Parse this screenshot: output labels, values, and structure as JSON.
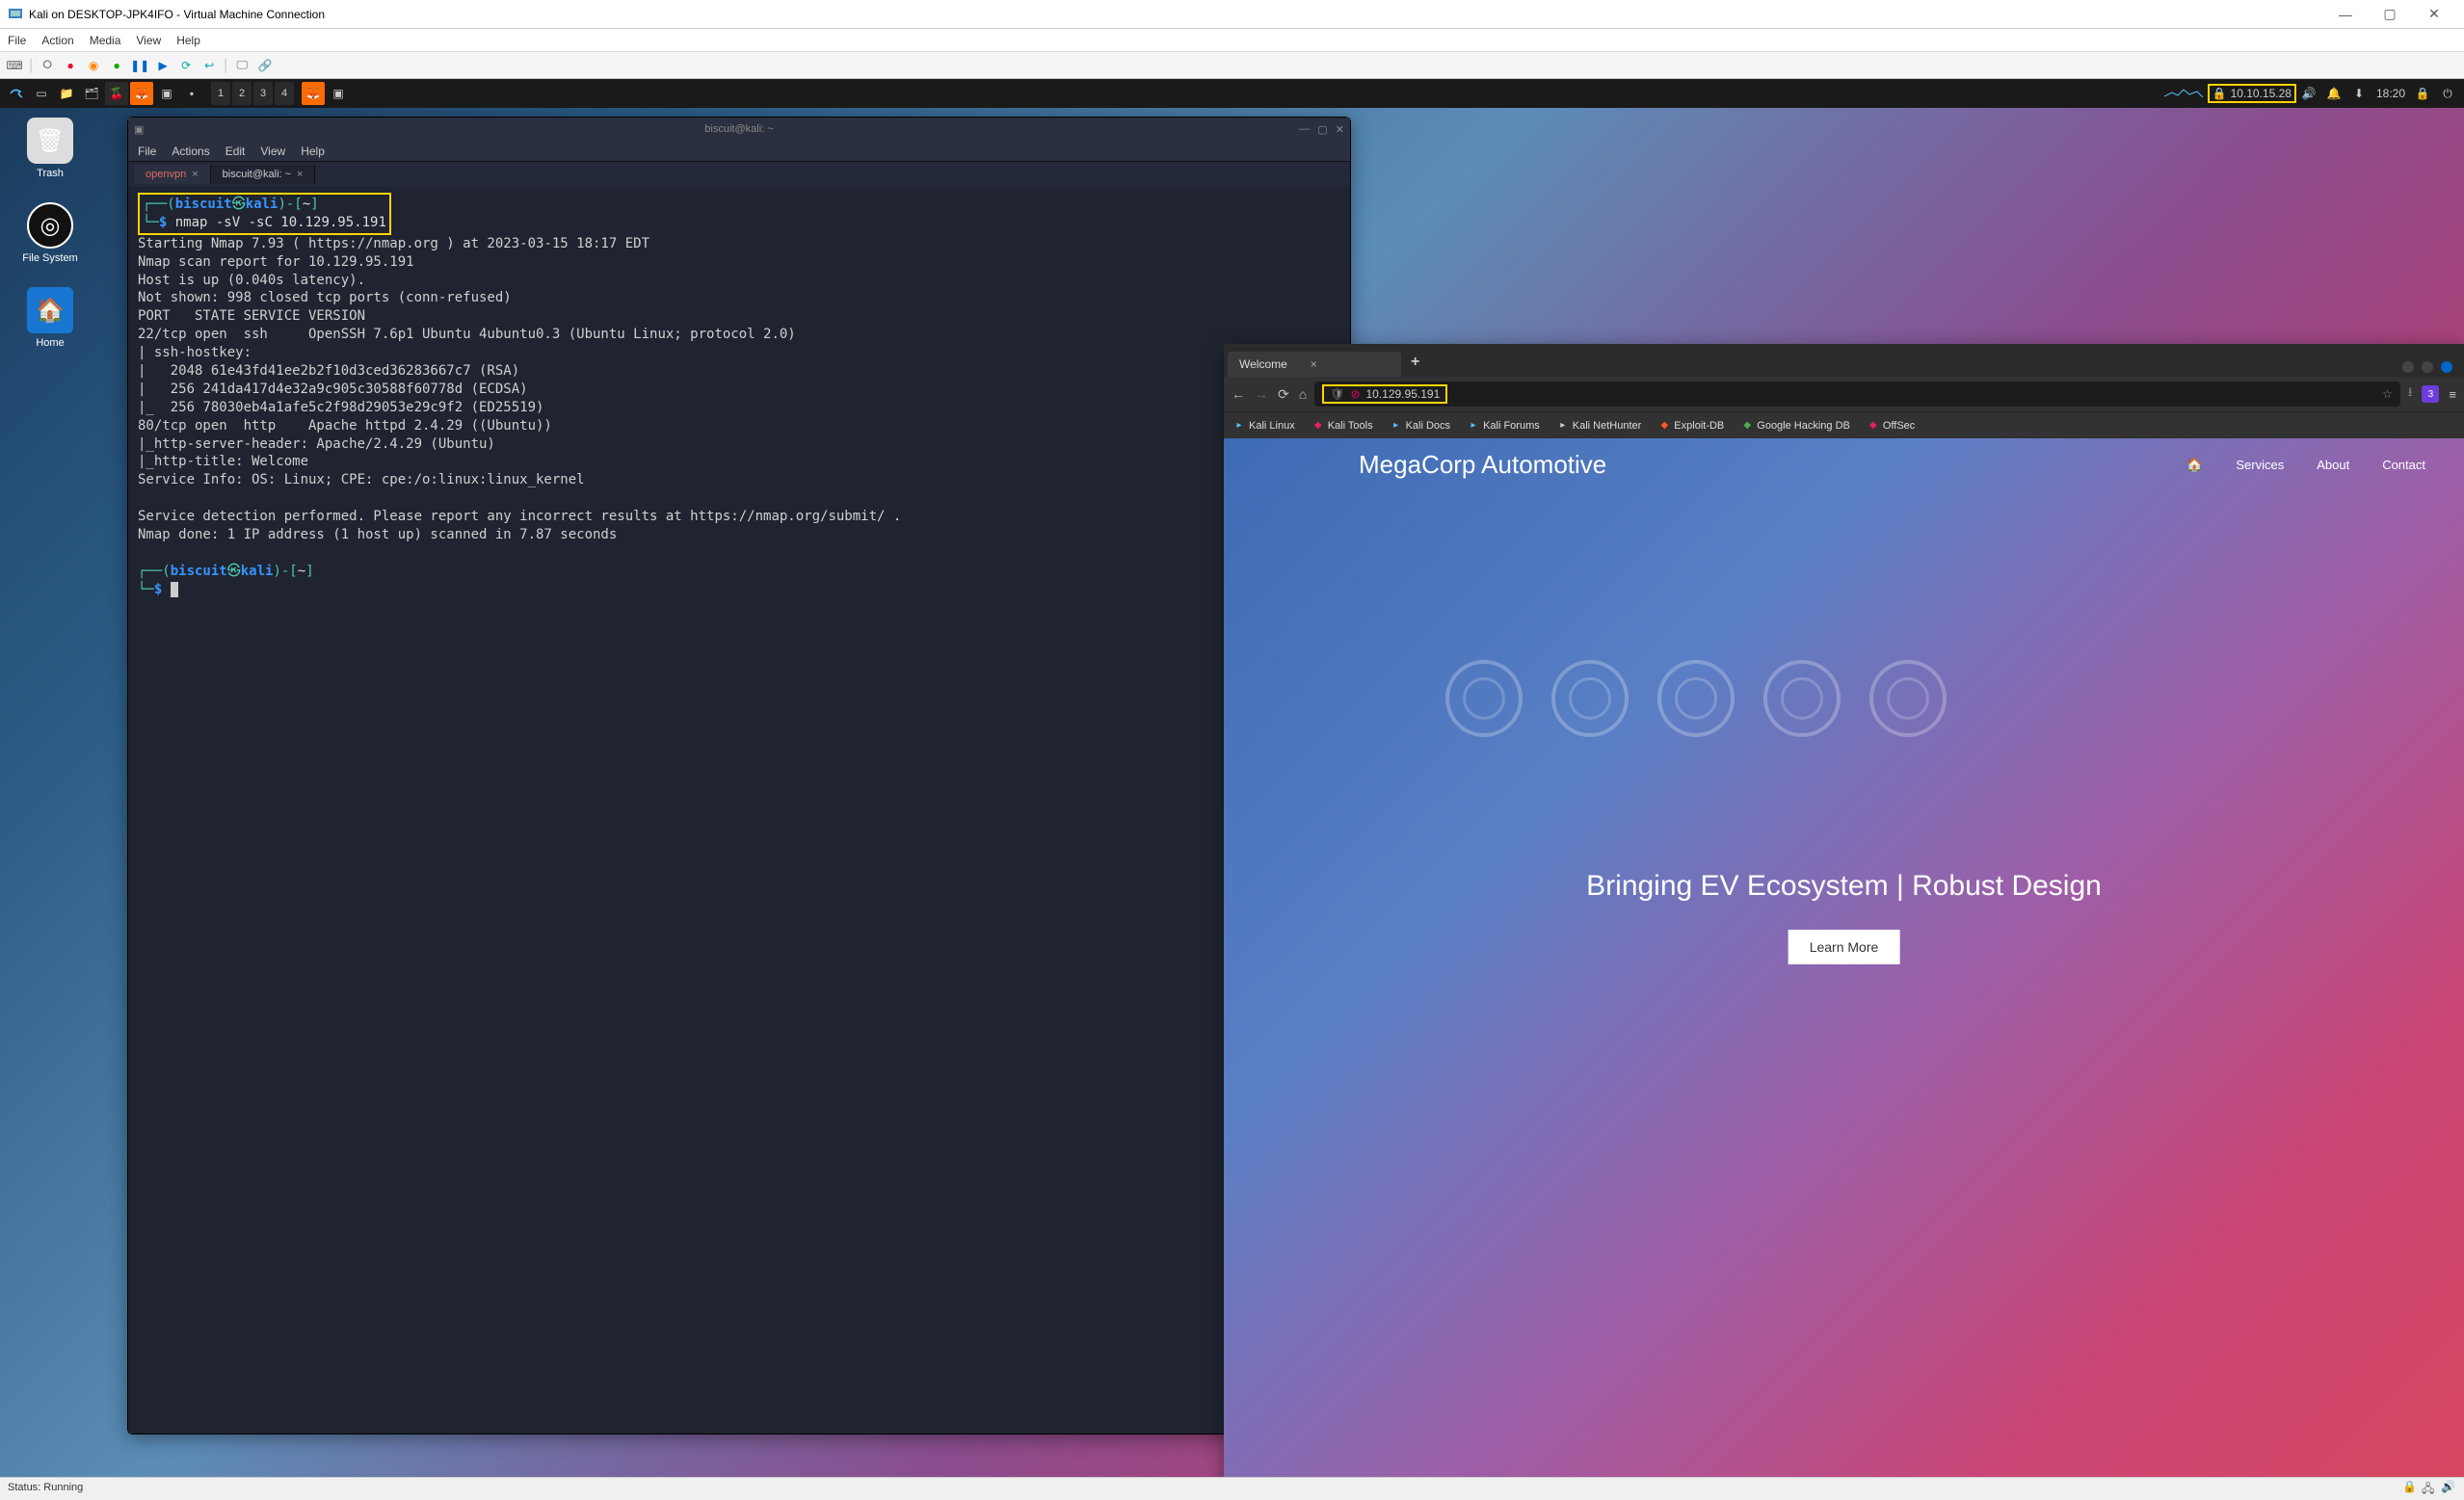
{
  "vm": {
    "title": "Kali on DESKTOP-JPK4IFO - Virtual Machine Connection",
    "menu": [
      "File",
      "Action",
      "Media",
      "View",
      "Help"
    ],
    "status": "Status: Running"
  },
  "kali_panel": {
    "workspaces": [
      "1",
      "2",
      "3",
      "4"
    ],
    "ip_badge": "10.10.15.28",
    "clock": "18:20"
  },
  "desktop": {
    "trash": "Trash",
    "filesystem": "File System",
    "home": "Home"
  },
  "terminal": {
    "title": "biscuit@kali: ~",
    "menu": [
      "File",
      "Actions",
      "Edit",
      "View",
      "Help"
    ],
    "tabs": [
      {
        "label": "openvpn",
        "active": false,
        "special": "ov"
      },
      {
        "label": "biscuit@kali: ~",
        "active": true
      }
    ],
    "prompt_user": "biscuit",
    "prompt_host": "kali",
    "prompt_path": "~",
    "cmd": "nmap -sV -sC 10.129.95.191",
    "output": "Starting Nmap 7.93 ( https://nmap.org ) at 2023-03-15 18:17 EDT\nNmap scan report for 10.129.95.191\nHost is up (0.040s latency).\nNot shown: 998 closed tcp ports (conn-refused)\nPORT   STATE SERVICE VERSION\n22/tcp open  ssh     OpenSSH 7.6p1 Ubuntu 4ubuntu0.3 (Ubuntu Linux; protocol 2.0)\n| ssh-hostkey: \n|   2048 61e43fd41ee2b2f10d3ced36283667c7 (RSA)\n|   256 241da417d4e32a9c905c30588f60778d (ECDSA)\n|_  256 78030eb4a1afe5c2f98d29053e29c9f2 (ED25519)\n80/tcp open  http    Apache httpd 2.4.29 ((Ubuntu))\n|_http-server-header: Apache/2.4.29 (Ubuntu)\n|_http-title: Welcome\nService Info: OS: Linux; CPE: cpe:/o:linux:linux_kernel\n\nService detection performed. Please report any incorrect results at https://nmap.org/submit/ .\nNmap done: 1 IP address (1 host up) scanned in 7.87 seconds"
  },
  "browser": {
    "tab_title": "Welcome",
    "url": "10.129.95.191",
    "bookmarks": [
      {
        "label": "Kali Linux",
        "icon": "kali"
      },
      {
        "label": "Kali Tools",
        "icon": "tools"
      },
      {
        "label": "Kali Docs",
        "icon": "docs"
      },
      {
        "label": "Kali Forums",
        "icon": "forums"
      },
      {
        "label": "Kali NetHunter",
        "icon": "nh"
      },
      {
        "label": "Exploit-DB",
        "icon": "edb"
      },
      {
        "label": "Google Hacking DB",
        "icon": "ghdb"
      },
      {
        "label": "OffSec",
        "icon": "offsec"
      }
    ],
    "ext_badge": "3"
  },
  "page": {
    "brand": "MegaCorp Automotive",
    "nav": [
      "Services",
      "About",
      "Contact"
    ],
    "hero_title": "Bringing EV Ecosystem | Robust Design",
    "hero_btn": "Learn More"
  }
}
